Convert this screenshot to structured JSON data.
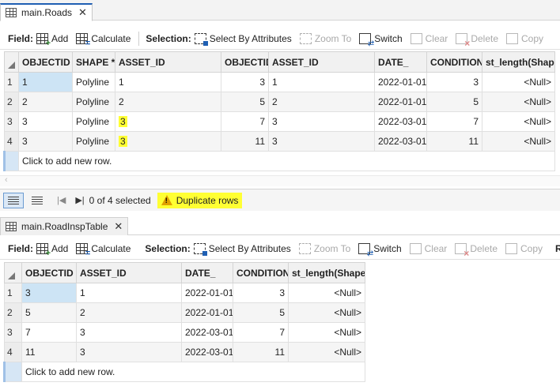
{
  "top_table": {
    "tab_title": "main.Roads",
    "toolbar": {
      "field_label": "Field:",
      "add": "Add",
      "calculate": "Calculate",
      "selection_label": "Selection:",
      "select_by_attributes": "Select By Attributes",
      "zoom_to": "Zoom To",
      "switch": "Switch",
      "clear": "Clear",
      "delete": "Delete",
      "copy": "Copy"
    },
    "columns": [
      "OBJECTID *",
      "SHAPE *",
      "ASSET_ID",
      "OBJECTID",
      "ASSET_ID",
      "DATE_",
      "CONDITION",
      "st_length(Shape)"
    ],
    "rows": [
      {
        "n": "1",
        "c": [
          "1",
          "Polyline",
          "1",
          "3",
          "1",
          "2022-01-01",
          "3",
          "<Null>"
        ]
      },
      {
        "n": "2",
        "c": [
          "2",
          "Polyline",
          "2",
          "5",
          "2",
          "2022-01-01",
          "5",
          "<Null>"
        ]
      },
      {
        "n": "3",
        "c": [
          "3",
          "Polyline",
          "3",
          "7",
          "3",
          "2022-03-01",
          "7",
          "<Null>"
        ]
      },
      {
        "n": "4",
        "c": [
          "3",
          "Polyline",
          "3",
          "11",
          "3",
          "2022-03-01",
          "11",
          "<Null>"
        ]
      }
    ],
    "add_row": "Click to add new row."
  },
  "statusbar": {
    "selected_text": "0 of 4 selected",
    "warning": "Duplicate rows"
  },
  "bottom_table": {
    "tab_title": "main.RoadInspTable",
    "close": "✕",
    "toolbar": {
      "field_label": "Field:",
      "add": "Add",
      "calculate": "Calculate",
      "selection_label": "Selection:",
      "select_by_attributes": "Select By Attributes",
      "zoom_to": "Zoom To",
      "switch": "Switch",
      "clear": "Clear",
      "delete": "Delete",
      "copy": "Copy",
      "overflow": "R"
    },
    "columns": [
      "OBJECTID *",
      "ASSET_ID",
      "DATE_",
      "CONDITION",
      "st_length(Shape)"
    ],
    "rows": [
      {
        "n": "1",
        "c": [
          "3",
          "1",
          "2022-01-01",
          "3",
          "<Null>"
        ]
      },
      {
        "n": "2",
        "c": [
          "5",
          "2",
          "2022-01-01",
          "5",
          "<Null>"
        ]
      },
      {
        "n": "3",
        "c": [
          "7",
          "3",
          "2022-03-01",
          "7",
          "<Null>"
        ]
      },
      {
        "n": "4",
        "c": [
          "11",
          "3",
          "2022-03-01",
          "11",
          "<Null>"
        ]
      }
    ],
    "add_row": "Click to add new row."
  },
  "colors": {
    "highlight": "#ffff33",
    "selected_cell": "#cde4f5",
    "tab_accent": "#1f5fb3"
  }
}
